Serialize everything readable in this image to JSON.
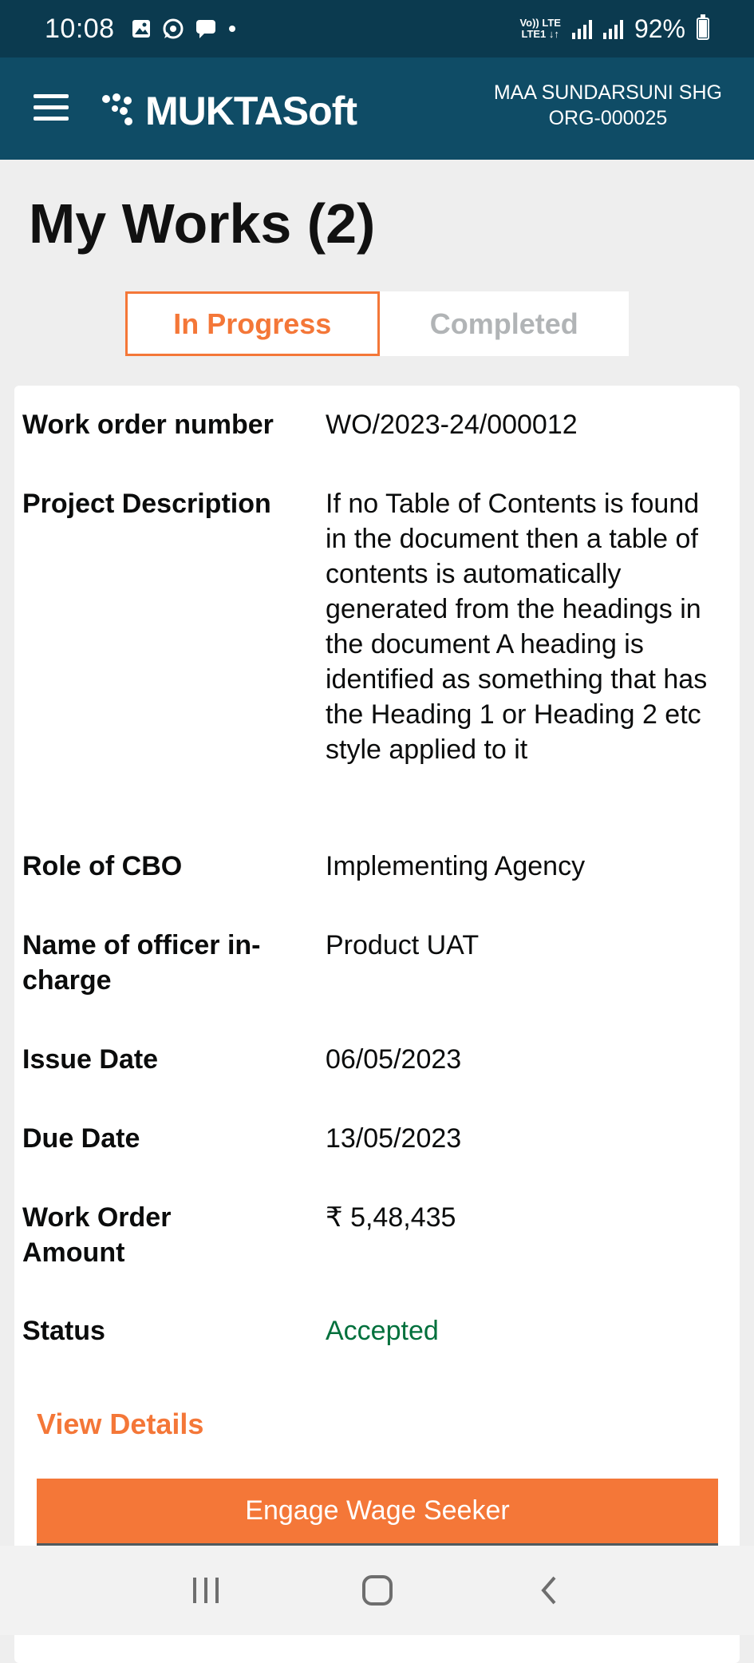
{
  "status_bar": {
    "time": "10:08",
    "net_label_1": "Vo)) LTE",
    "net_label_2": "LTE1 ↓↑",
    "battery_percent": "92%",
    "icons": [
      "gallery-icon",
      "whatsapp-icon",
      "message-icon",
      "dot-icon",
      "signal-icon",
      "battery-icon"
    ]
  },
  "header": {
    "app_name": "MUKTASoft",
    "org_name": "MAA SUNDARSUNI SHG",
    "org_id": "ORG-000025"
  },
  "page": {
    "title": "My Works (2)"
  },
  "tabs": {
    "in_progress": "In Progress",
    "completed": "Completed",
    "active": "in_progress"
  },
  "work": {
    "work_order_number_label": "Work order number",
    "work_order_number": "WO/2023-24/000012",
    "project_description_label": "Project Description",
    "project_description": "If no Table of Contents is found in the document then a table of contents is automatically generated from the headings in the document A heading is identified as something that has the Heading 1 or Heading 2 etc style applied to it",
    "role_label": "Role of CBO",
    "role": "Implementing Agency",
    "officer_label": "Name of officer in-charge",
    "officer": "Product UAT",
    "issue_date_label": "Issue Date",
    "issue_date": "06/05/2023",
    "due_date_label": "Due Date",
    "due_date": "13/05/2023",
    "amount_label": "Work Order Amount",
    "amount": "₹ 5,48,435",
    "status_label": "Status",
    "status": "Accepted"
  },
  "actions": {
    "view_details": "View Details",
    "engage": "Engage Wage Seeker"
  },
  "colors": {
    "header_bg": "#0f4c66",
    "status_bg": "#0b3a4f",
    "accent": "#f47738",
    "success": "#00703c"
  }
}
